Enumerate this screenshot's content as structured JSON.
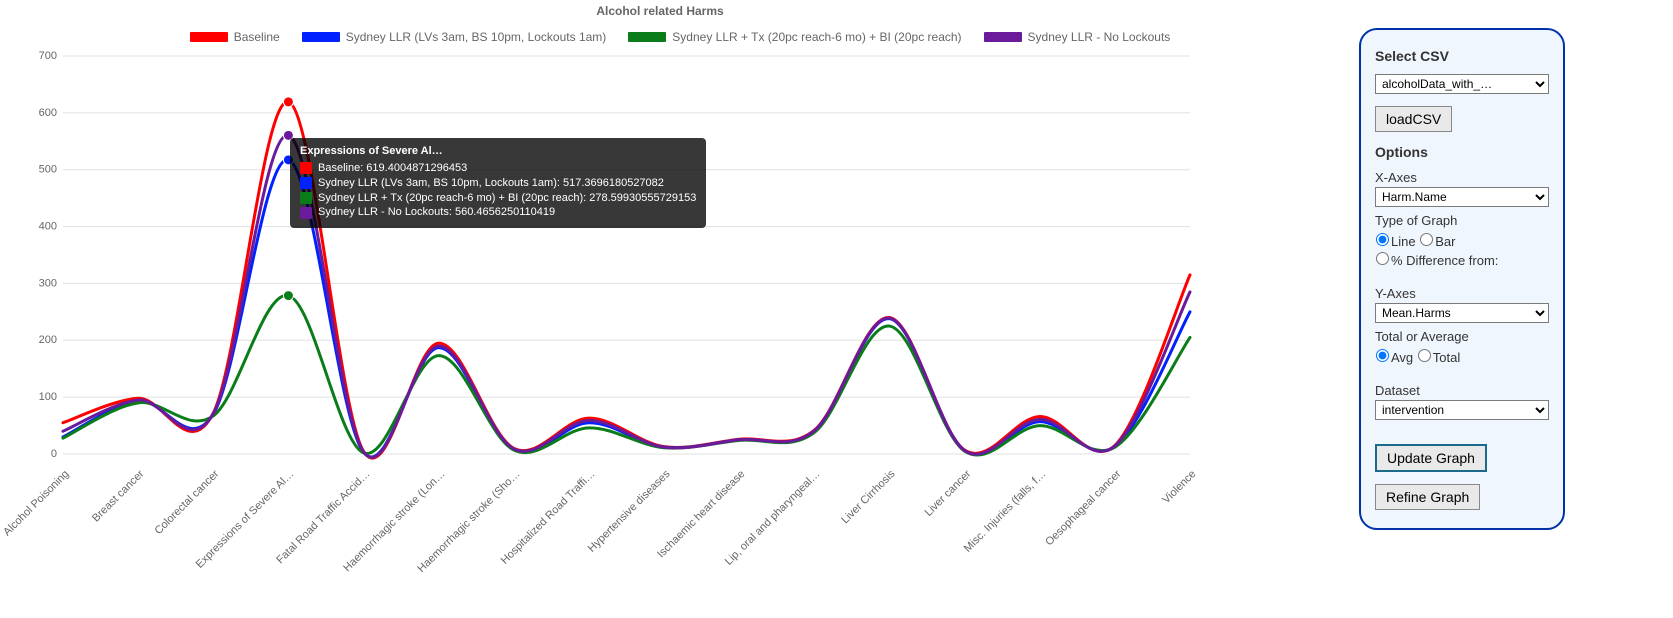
{
  "chart_data": {
    "type": "line",
    "title": "Alcohol related Harms",
    "xlabel": "",
    "ylabel": "",
    "ylim": [
      0,
      700
    ],
    "yticks": [
      0,
      100,
      200,
      300,
      400,
      500,
      600,
      700
    ],
    "categories": [
      "Alcohol Poisoning",
      "Breast cancer",
      "Colorectal cancer",
      "Expressions of Severe Al…",
      "Fatal Road Traffic Accid…",
      "Haemorrhagic stroke (Lon…",
      "Haemorrhagic stroke (Sho…",
      "Hospitalized Road Traffi…",
      "Hypertensive diseases",
      "Ischaemic heart disease",
      "Lip, oral and pharyngeal…",
      "Liver Cirrhosis",
      "Liver cancer",
      "Misc. Injuries (falls, f…",
      "Oesophageal cancer",
      "Violence"
    ],
    "series": [
      {
        "name": "Baseline",
        "color": "#ff0000",
        "values": [
          55,
          98,
          72,
          619.4004871296453,
          5,
          195,
          10,
          63,
          13,
          26,
          42,
          240,
          7,
          66,
          15,
          315
        ]
      },
      {
        "name": "Sydney LLR (LVs 3am, BS 10pm, Lockouts 1am)",
        "color": "#0022ff",
        "values": [
          30,
          93,
          70,
          517.3696180527082,
          3,
          187,
          8,
          55,
          12,
          25,
          40,
          238,
          6,
          57,
          13,
          250
        ]
      },
      {
        "name": "Sydney LLR + Tx (20pc reach-6 mo) + BI (20pc reach)",
        "color": "#0a7d1a",
        "values": [
          28,
          90,
          67,
          278.59930555729153,
          2,
          173,
          7,
          46,
          11,
          24,
          38,
          225,
          5,
          50,
          12,
          205
        ]
      },
      {
        "name": "Sydney LLR - No Lockouts",
        "color": "#6a1a9a",
        "values": [
          40,
          95,
          71,
          560.4656250110419,
          4,
          190,
          9,
          59,
          12,
          25,
          41,
          239,
          6,
          61,
          14,
          285
        ]
      }
    ],
    "hover_index": 3,
    "tooltip": {
      "title": "Expressions of Severe Al…",
      "rows": [
        {
          "color": "#ff0000",
          "text": "Baseline: 619.4004871296453"
        },
        {
          "color": "#0022ff",
          "text": "Sydney LLR (LVs 3am, BS 10pm, Lockouts 1am): 517.3696180527082"
        },
        {
          "color": "#0a7d1a",
          "text": "Sydney LLR + Tx (20pc reach-6 mo) + BI (20pc reach): 278.59930555729153"
        },
        {
          "color": "#6a1a9a",
          "text": "Sydney LLR - No Lockouts: 560.4656250110419"
        }
      ]
    }
  },
  "panel": {
    "select_csv_label": "Select CSV",
    "csv_value": "alcoholData_with_…",
    "load_csv_label": "loadCSV",
    "options_label": "Options",
    "x_axes_label": "X-Axes",
    "x_axes_value": "Harm.Name",
    "type_of_graph_label": "Type of Graph",
    "type_line": "Line",
    "type_bar": "Bar",
    "type_pct": "% Difference from:",
    "y_axes_label": "Y-Axes",
    "y_axes_value": "Mean.Harms",
    "total_or_avg_label": "Total or Average",
    "avg": "Avg",
    "total": "Total",
    "dataset_label": "Dataset",
    "dataset_value": "intervention",
    "update_label": "Update Graph",
    "refine_label": "Refine Graph"
  }
}
